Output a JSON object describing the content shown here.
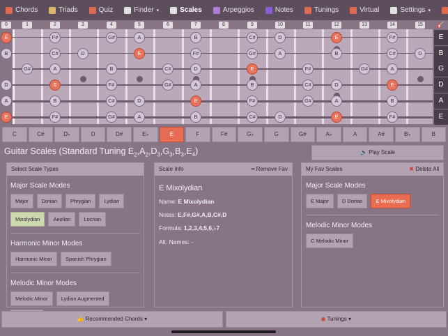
{
  "nav": {
    "items": [
      {
        "label": "Chords",
        "icon": "guitar-icon",
        "color": "#e06a4f"
      },
      {
        "label": "Triads",
        "icon": "triads-icon",
        "color": "#d9b86a"
      },
      {
        "label": "Quiz",
        "icon": "quiz-icon",
        "color": "#e06a4f"
      },
      {
        "label": "Finder",
        "icon": "finder-icon",
        "color": "#e0e0e0",
        "caret": "▾"
      },
      {
        "label": "Scales",
        "icon": "scales-icon",
        "color": "#e0e0e0",
        "active": true
      },
      {
        "label": "Arpeggios",
        "icon": "arpeggio-icon",
        "color": "#b07fd6"
      },
      {
        "label": "Notes",
        "icon": "notes-icon",
        "color": "#8a5cd6"
      },
      {
        "label": "Tunings",
        "icon": "tunings-icon",
        "color": "#e06a4f"
      },
      {
        "label": "Virtual",
        "icon": "guitar-icon",
        "color": "#e06a4f"
      },
      {
        "label": "Settings",
        "icon": "gear-icon",
        "color": "#e0e0e0",
        "caret": "▾"
      },
      {
        "label": "Help",
        "icon": "help-icon",
        "color": "#e06a4f"
      }
    ]
  },
  "fretboard": {
    "fret_numbers": [
      "0",
      "1",
      "2",
      "3",
      "4",
      "5",
      "6",
      "7",
      "8",
      "9",
      "10",
      "11",
      "12",
      "13",
      "14",
      "15"
    ],
    "string_labels": [
      "E",
      "B",
      "G",
      "D",
      "A",
      "E"
    ],
    "open_notes": [
      "E",
      "B",
      "",
      "D",
      "A",
      "E"
    ]
  },
  "keys": [
    "C",
    "C#",
    "D♭",
    "D",
    "D#",
    "E♭",
    "E",
    "F",
    "F#",
    "G♭",
    "G",
    "G#",
    "A♭",
    "A",
    "A#",
    "B♭",
    "B"
  ],
  "active_key": "E",
  "title": {
    "main": "Guitar Scales (Standard Tuning E",
    "tuning_parts": [
      {
        "note": "E",
        "sub": "2"
      },
      {
        "note": "A",
        "sub": "2"
      },
      {
        "note": "D",
        "sub": "3"
      },
      {
        "note": "G",
        "sub": "3"
      },
      {
        "note": "B",
        "sub": "3"
      },
      {
        "note": "E",
        "sub": "4"
      }
    ],
    "play_label": "Play Scale"
  },
  "panels": {
    "types": {
      "header": "Select Scale Types",
      "groups": [
        {
          "title": "Major Scale Modes",
          "items": [
            "Major",
            "Dorian",
            "Phrygian",
            "Lydian",
            "Mixolydian",
            "Aeolian",
            "Locrian"
          ],
          "active": "Mixolydian"
        },
        {
          "title": "Harmonic Minor Modes",
          "items": [
            "Harmonic Minor",
            "Spanish Phrygian"
          ]
        },
        {
          "title": "Melodic Minor Modes",
          "items": [
            "Melodic Minor",
            "Lydian Augmented",
            "Dorian b2"
          ]
        }
      ]
    },
    "info": {
      "header": "Scale Info",
      "remove_label": "Remove Fav",
      "name": "E Mixolydian",
      "name_label": "Name:",
      "name_value": "E Mixolydian",
      "notes_label": "Notes:",
      "notes_value": "E,F#,G#,A,B,C#,D",
      "formula_label": "Formula:",
      "formula_value": "1,2,3,4,5,6,♭7",
      "alt_label": "Alt. Names:",
      "alt_value": "-"
    },
    "fav": {
      "header": "My Fav Scales",
      "delete_label": "Delete All",
      "groups": [
        {
          "title": "Major Scale Modes",
          "items": [
            "E Major",
            "D Dorian",
            "E Mixolydian"
          ],
          "active": "E Mixolydian"
        },
        {
          "title": "Melodic Minor Modes",
          "items": [
            "C Melodic Minor"
          ]
        }
      ]
    }
  },
  "bottom": {
    "chords_label": "Recommended Chords",
    "tunings_label": "Tunings",
    "caret": "▾"
  },
  "colors": {
    "root": "#e8745d",
    "note": "#d2c6d7",
    "bg": "#877586"
  }
}
